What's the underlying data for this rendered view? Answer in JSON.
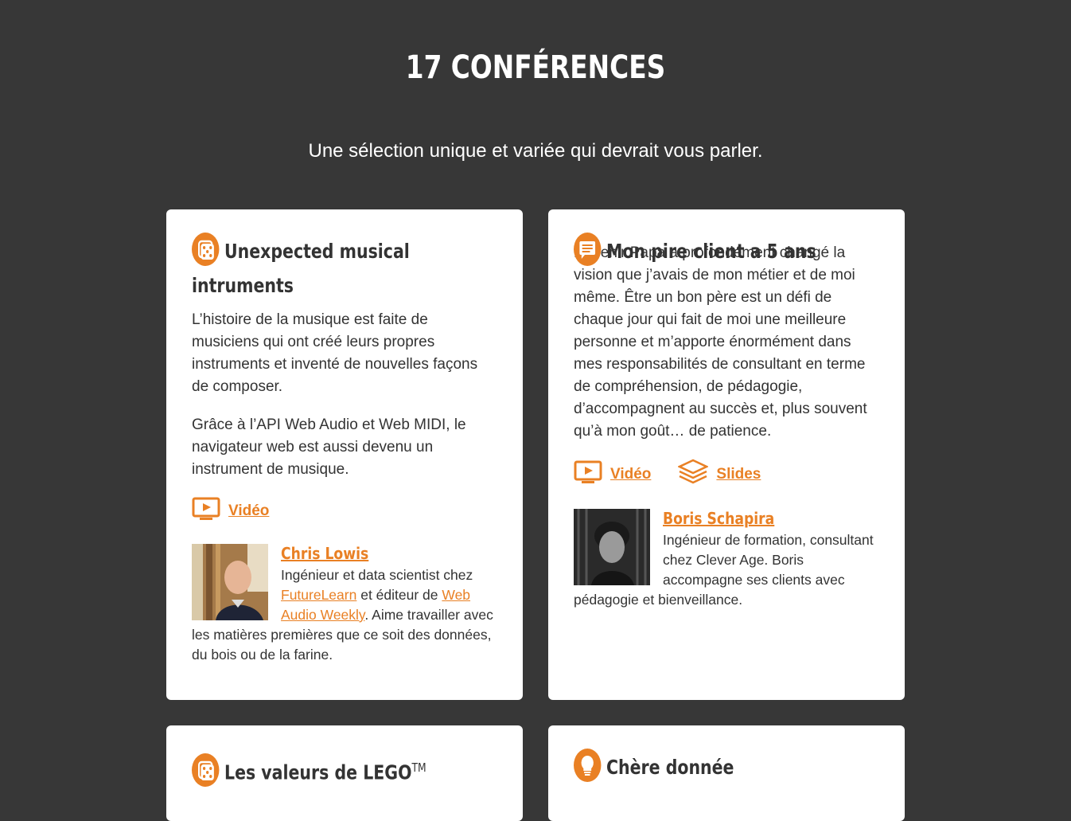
{
  "header": {
    "title": "17 CONFÉRENCES",
    "subtitle": "Une sélection unique et variée qui devrait vous parler."
  },
  "colors": {
    "background": "#373737",
    "accent": "#e98024",
    "card": "#ffffff",
    "text": "#333333"
  },
  "talks": [
    {
      "icon": "dice-icon",
      "title": "Unexpected musical intruments",
      "paragraphs": [
        "L’histoire de la musique est faite de musiciens qui ont créé leurs propres instruments et inventé de nouvelles façons de composer.",
        "Grâce à l’API Web Audio et Web MIDI, le navigateur web est aussi devenu un instrument de musique."
      ],
      "links": {
        "video": "Vidéo"
      },
      "speaker": {
        "name": "Chris Lowis",
        "bio_1": "Ingénieur et data scientist chez ",
        "bio_link_1": "FutureLearn",
        "bio_2": " et éditeur de ",
        "bio_link_2": "Web Audio Weekly",
        "bio_3": ". Aime travailler avec les matières premières que ce soit des données, du bois ou de la farine."
      }
    },
    {
      "icon": "chat-icon",
      "title": "Mon pire client a 5 ans",
      "paragraphs": [
        "Devenir Papa a profondément changé la vision que j’avais de mon métier et de moi même. Être un bon père est un défi de chaque jour qui fait de moi une meilleure personne et m’apporte énormément dans mes responsabilités de consultant en terme de compréhension, de pédagogie, d’accompagnent au succès et, plus souvent qu’à mon goût… de patience."
      ],
      "links": {
        "video": "Vidéo",
        "slides": "Slides"
      },
      "speaker": {
        "name": "Boris Schapira",
        "bio": "Ingénieur de formation, consultant chez Clever Age. Boris accompagne ses clients avec pédagogie et bienveillance."
      }
    },
    {
      "icon": "dice-icon",
      "title": "Les valeurs de LEGO",
      "title_sup": "TM"
    },
    {
      "icon": "lightbulb-icon",
      "title": "Chère donnée"
    }
  ]
}
